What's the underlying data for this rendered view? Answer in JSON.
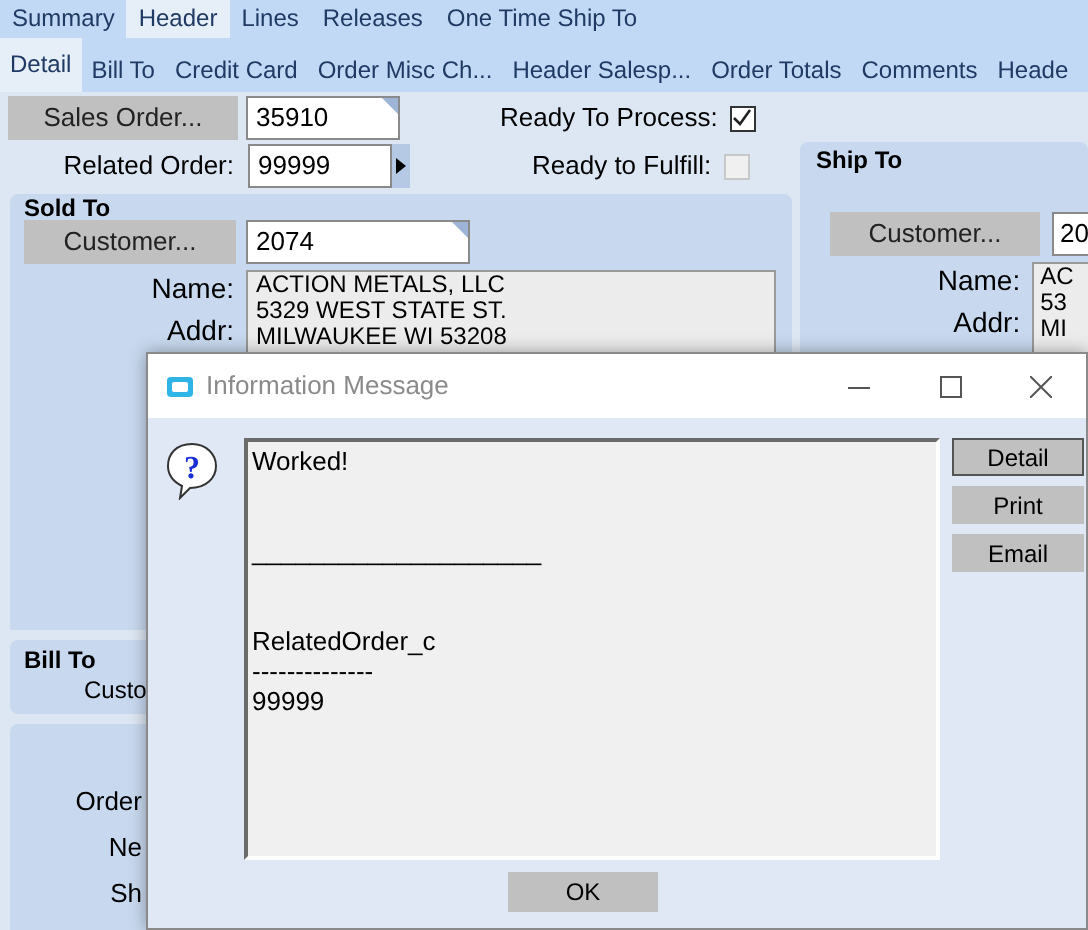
{
  "tabs": [
    {
      "label": "Summary",
      "selected": false
    },
    {
      "label": "Header",
      "selected": true
    },
    {
      "label": "Lines",
      "selected": false
    },
    {
      "label": "Releases",
      "selected": false
    },
    {
      "label": "One Time Ship To",
      "selected": false
    }
  ],
  "subtabs": [
    {
      "label": "Detail",
      "selected": true
    },
    {
      "label": "Bill To",
      "selected": false
    },
    {
      "label": "Credit Card",
      "selected": false
    },
    {
      "label": "Order Misc Ch...",
      "selected": false
    },
    {
      "label": "Header Salesp...",
      "selected": false
    },
    {
      "label": "Order Totals",
      "selected": false
    },
    {
      "label": "Comments",
      "selected": false
    },
    {
      "label": "Heade",
      "selected": false
    }
  ],
  "sales_order": {
    "button": "Sales Order...",
    "value": "35910"
  },
  "related_order": {
    "label": "Related Order:",
    "value": "99999"
  },
  "ready_to_process": {
    "label": "Ready To Process:",
    "checked": true,
    "disabled": false
  },
  "ready_to_fulfill": {
    "label": "Ready to Fulfill:",
    "checked": false,
    "disabled": true
  },
  "sold_to": {
    "title": "Sold To",
    "customer_button": "Customer...",
    "customer_value": "2074",
    "name_label": "Name:",
    "addr_label": "Addr:",
    "address_lines": [
      "ACTION METALS, LLC",
      "5329 WEST STATE ST.",
      "MILWAUKEE WI 53208"
    ]
  },
  "ship_to": {
    "title": "Ship To",
    "customer_button": "Customer...",
    "customer_value": "20",
    "name_label": "Name:",
    "addr_label": "Addr:",
    "address_lines": [
      "AC",
      "53",
      "MI"
    ]
  },
  "bill_to": {
    "title": "Bill To",
    "label": "Custo"
  },
  "lower_panel": {
    "labels": [
      "Order",
      "Ne",
      "Sh"
    ]
  },
  "dialog": {
    "title": "Information Message",
    "icon_glyph": "?",
    "message": {
      "status": "Worked!",
      "rule": "____________________",
      "field_name": "RelatedOrder_c",
      "underline": "--------------",
      "value": "99999"
    },
    "side_buttons": [
      "Detail",
      "Print",
      "Email"
    ],
    "ok": "OK"
  }
}
